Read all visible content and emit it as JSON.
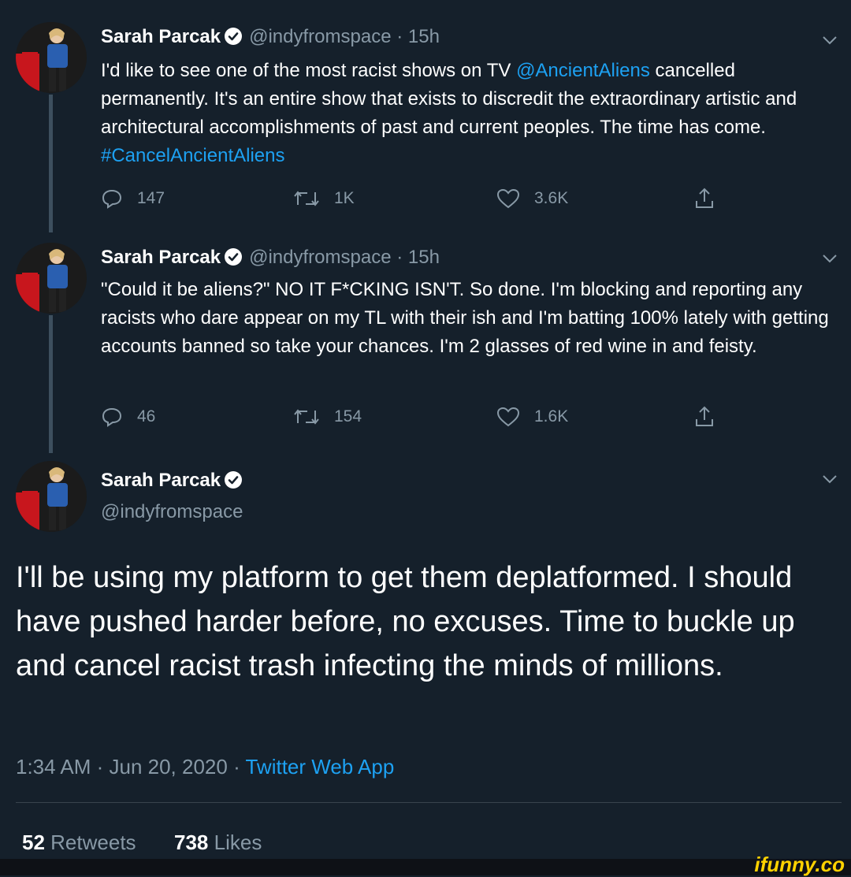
{
  "tweets": [
    {
      "name": "Sarah Parcak",
      "handle": "@indyfromspace",
      "separator": "·",
      "time": "15h",
      "text_parts": {
        "a": "I'd like to see one of the most racist shows on TV ",
        "mention": "@AncientAliens",
        "b": " cancelled permanently. It's an entire show that exists to discredit the extraordinary artistic and architectural accomplishments of past and current peoples. The time has come. ",
        "hashtag": "#CancelAncientAliens"
      },
      "replies": "147",
      "retweets": "1K",
      "likes": "3.6K"
    },
    {
      "name": "Sarah Parcak",
      "handle": "@indyfromspace",
      "separator": "·",
      "time": "15h",
      "text": "\"Could it be aliens?\" NO IT F*CKING ISN'T. So done. I'm blocking and reporting any racists who dare appear on my TL with their ish and I'm batting 100% lately with getting accounts banned so take your chances. I'm 2 glasses of red wine in and feisty.",
      "replies": "46",
      "retweets": "154",
      "likes": "1.6K"
    }
  ],
  "main_tweet": {
    "name": "Sarah Parcak",
    "handle": "@indyfromspace",
    "text": "I'll be using my platform to get them deplatformed. I should have pushed harder before, no excuses. Time to buckle up and cancel racist trash infecting the minds of millions.",
    "timestamp": "1:34 AM · Jun 20, 2020 · ",
    "source": "Twitter Web App",
    "retweet_count": "52",
    "retweet_label": "Retweets",
    "like_count": "738",
    "like_label": "Likes"
  },
  "watermark": "ifunny.co",
  "icons": [
    "verified-badge-icon",
    "chevron-down-icon",
    "reply-icon",
    "retweet-icon",
    "like-icon",
    "share-icon"
  ],
  "colors": {
    "background": "#15202b",
    "accent": "#1da1f2",
    "muted": "#8899a6"
  }
}
